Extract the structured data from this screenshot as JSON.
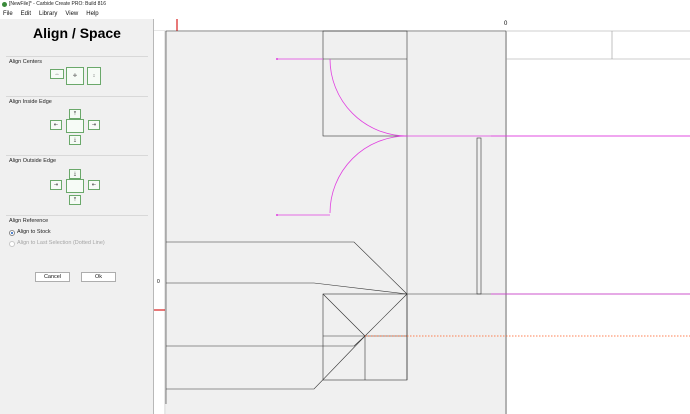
{
  "window": {
    "title": "[NewFile]* - Carbide Create PRO: Build 816"
  },
  "menu": [
    {
      "label": "File"
    },
    {
      "label": "Edit"
    },
    {
      "label": "Library"
    },
    {
      "label": "View"
    },
    {
      "label": "Help"
    }
  ],
  "panel": {
    "title": "Align / Space",
    "align_centers_label": "Align Centers",
    "align_inside_label": "Align Inside Edge",
    "align_outside_label": "Align Outside Edge",
    "align_reference_label": "Align Reference",
    "ref_options": [
      {
        "label": "Align to Stock",
        "selected": true
      },
      {
        "label": "Align to Last Selection (Dotted Line)",
        "selected": false
      }
    ],
    "cancel_label": "Cancel",
    "ok_label": "Ok"
  },
  "ruler": {
    "zero_label": "0",
    "v_zero_label": "0"
  },
  "colors": {
    "accent": "#1f5fbf",
    "magenta": "#e040e0",
    "orange": "#ff5a1e",
    "ruler_marker": "#d81e1e"
  }
}
